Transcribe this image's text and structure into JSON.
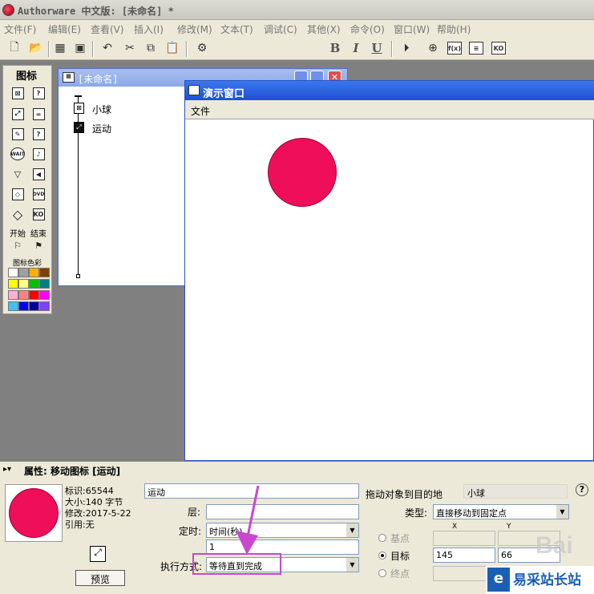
{
  "app": {
    "title": "Authorware 中文版: [未命名] *"
  },
  "menu": [
    "文件(F)",
    "编辑(E)",
    "查看(V)",
    "插入(I)",
    "修改(M)",
    "文本(T)",
    "调试(C)",
    "其他(X)",
    "命令(O)",
    "窗口(W)",
    "帮助(H)"
  ],
  "palette": {
    "title": "图标",
    "start": "开始",
    "end": "结束",
    "colors_label": "图标色彩",
    "icons": [
      "display",
      "decision",
      "move",
      "calc",
      "erase",
      "interaction",
      "wait",
      "frame",
      "navigate",
      "video",
      "map",
      "sound",
      "nav-decision",
      "ko"
    ],
    "icon_texts": {
      "wait": "WAIT",
      "dvd": "DVD",
      "ko": "KO"
    },
    "swatches": [
      "#ffffff",
      "#a0a0a0",
      "#ffb000",
      "#804000",
      "#ffff00",
      "#ffff80",
      "#00c000",
      "#008080",
      "#ffb0d0",
      "#ff8080",
      "#ff0000",
      "#ff00ff",
      "#40c0ff",
      "#0000ff",
      "#0000a0",
      "#8040ff"
    ]
  },
  "flow_window": {
    "title": "[未命名]",
    "items": [
      {
        "label": "小球"
      },
      {
        "label": "运动"
      }
    ]
  },
  "presentation": {
    "title": "演示窗口",
    "menu": "文件",
    "ball_color": "#ef0e5a"
  },
  "properties": {
    "header": "属性: 移动图标 [运动]",
    "info": {
      "id": "标识:65544",
      "size": "大小:140 字节",
      "modified": "修改:2017-5-22",
      "ref": "引用:无"
    },
    "preview_label": "预览",
    "name_value": "运动",
    "layer_label": "层:",
    "layer_value": "",
    "timing_label": "定时:",
    "timing_value": "时间(秒)",
    "timing_amount": "1",
    "exec_label": "执行方式:",
    "exec_value": "等待直到完成",
    "drag_label": "拖动对象到目的地",
    "drag_target": "小球",
    "type_label": "类型:",
    "type_value": "直接移动到固定点",
    "x_label": "X",
    "y_label": "Y",
    "base_label": "基点",
    "target_label": "目标",
    "end_label": "终点",
    "target_x": "145",
    "target_y": "66",
    "help": "?"
  },
  "watermark": {
    "brand": "易采站长站",
    "baidu": "Bai"
  },
  "colors": {
    "highlight_box": "#c848d0",
    "arrow": "#c848d0"
  }
}
